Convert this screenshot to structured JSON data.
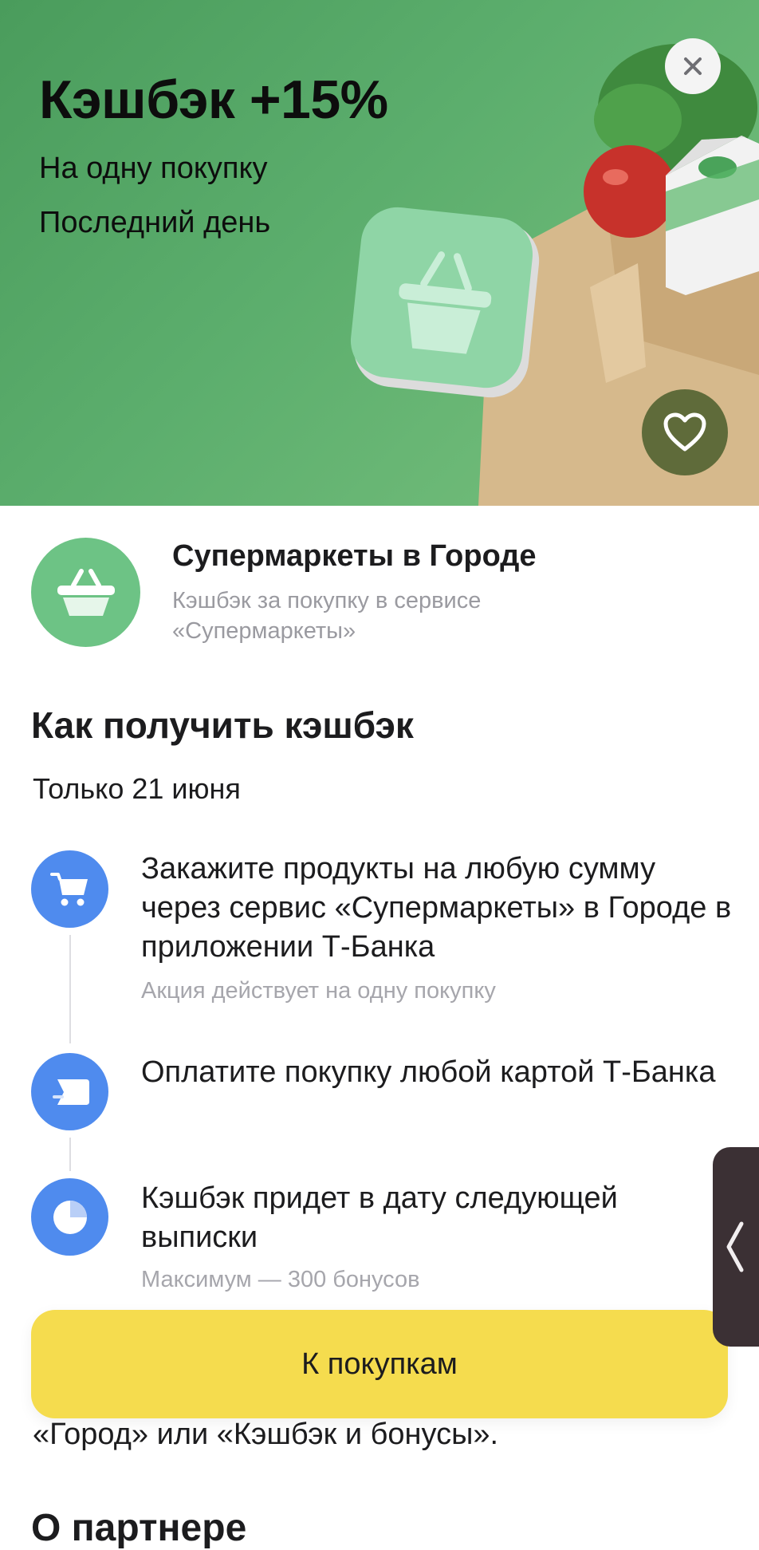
{
  "hero": {
    "title": "Кэшбэк +15%",
    "subtitle_1": "На одну покупку",
    "subtitle_2": "Последний день",
    "close_icon": "close-icon",
    "favorite_icon": "heart-icon"
  },
  "partner": {
    "name": "Супермаркеты в Городе",
    "description": "Кэшбэк за покупку в сервисе «Супермаркеты»",
    "logo_icon": "basket-icon"
  },
  "how_to": {
    "title": "Как получить кэшбэк",
    "date": "Только 21 июня",
    "steps": [
      {
        "icon": "cart-icon",
        "text": "Закажите продукты на любую сумму через сервис «Супермаркеты» в Городе в приложении Т-Банка",
        "note": "Акция действует на одну покупку"
      },
      {
        "icon": "card-icon",
        "text": "Оплатите покупку любой картой Т-Банка",
        "note": ""
      },
      {
        "icon": "pie-chart-icon",
        "text": "Кэшбэк придет в дату следующей выписки",
        "note": "Максимум — 300 бонусов"
      }
    ]
  },
  "cta": {
    "label": "К покупкам"
  },
  "tail": {
    "text": "«Город» или «Кэшбэк и бонусы».",
    "next_heading": "О партнере"
  },
  "colors": {
    "hero_green": "#5cae6d",
    "partner_green": "#6dc385",
    "step_blue": "#4f8bee",
    "cta_yellow": "#f5dc4e"
  }
}
